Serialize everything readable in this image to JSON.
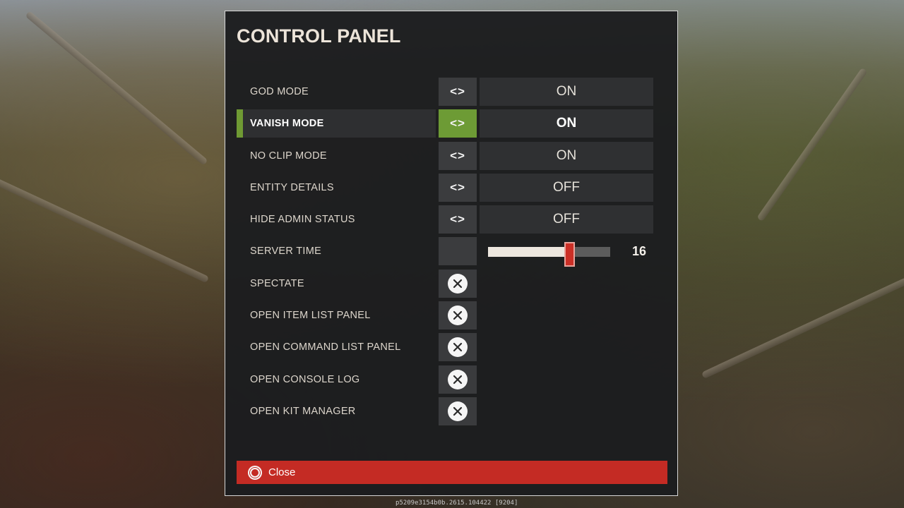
{
  "panel": {
    "title": "CONTROL PANEL",
    "toggles": [
      {
        "label": "GOD MODE",
        "value": "ON",
        "selected": false
      },
      {
        "label": "VANISH MODE",
        "value": "ON",
        "selected": true
      },
      {
        "label": "NO CLIP MODE",
        "value": "ON",
        "selected": false
      },
      {
        "label": "ENTITY DETAILS",
        "value": "OFF",
        "selected": false
      },
      {
        "label": "HIDE ADMIN STATUS",
        "value": "OFF",
        "selected": false
      }
    ],
    "server_time": {
      "label": "SERVER TIME",
      "value": "16",
      "slider_fraction": 0.67
    },
    "actions": [
      {
        "label": "SPECTATE"
      },
      {
        "label": "OPEN ITEM LIST PANEL"
      },
      {
        "label": "OPEN COMMAND LIST PANEL"
      },
      {
        "label": "OPEN CONSOLE LOG"
      },
      {
        "label": "OPEN KIT MANAGER"
      }
    ],
    "close_label": "Close"
  },
  "footer": {
    "build_id": "p5209e3154b0b.2615.104422 [9204]"
  },
  "colors": {
    "accent_green": "#6d9b35",
    "close_red": "#c42b24",
    "slider_thumb": "#cb2f26"
  },
  "icons": {
    "toggle": "left-right-arrows-icon",
    "action": "close-circle-icon",
    "close": "radio-circle-icon"
  }
}
